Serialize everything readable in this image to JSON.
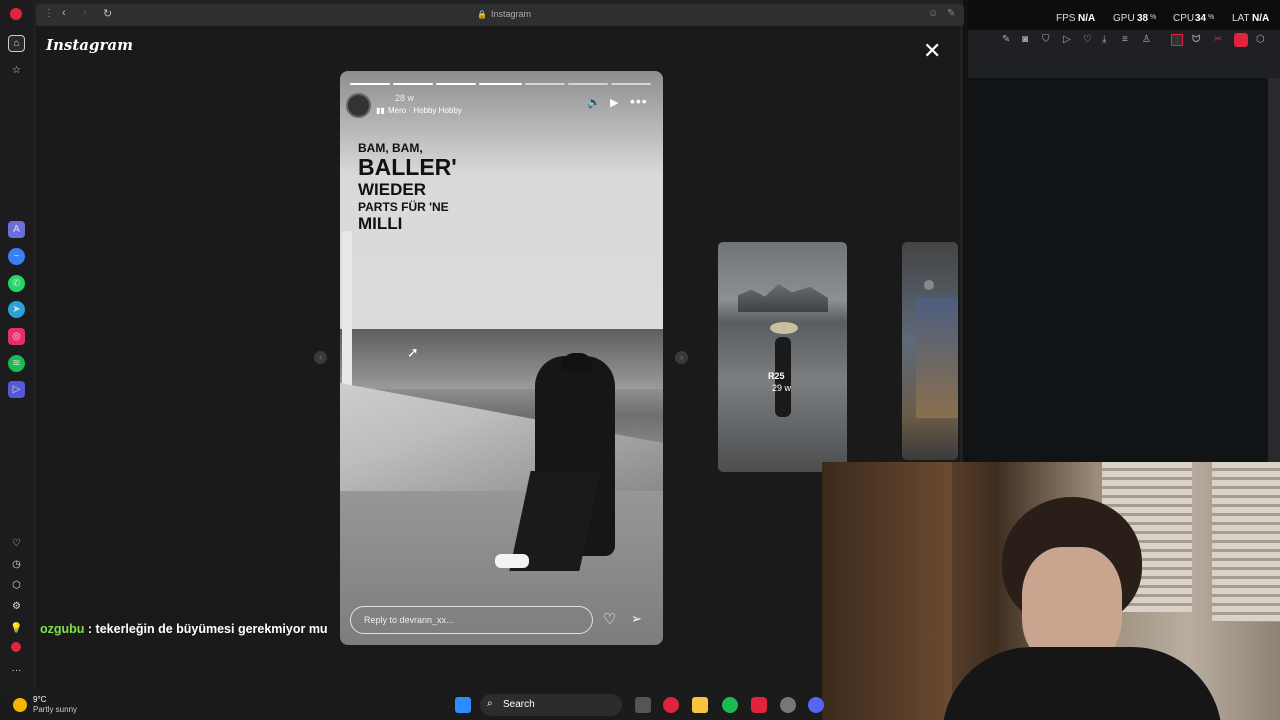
{
  "browser": {
    "url_label": "Instagram",
    "app_logo": "Instagram"
  },
  "story": {
    "username_time": "28 w",
    "music": "Mero · Hobby Hobby",
    "lyrics": [
      "BAM, BAM,",
      "BALLER'",
      "WIEDER",
      "PARTS FÜR 'NE",
      "MILLI"
    ],
    "reply_placeholder": "Reply to devrann_xx..."
  },
  "next_story": {
    "label": "R25",
    "time": "29 w"
  },
  "overlay": {
    "fps_label": "FPS",
    "fps_value": "N/A",
    "gpu_label": "GPU",
    "gpu_value": "38",
    "gpu_unit": "%",
    "cpu_label": "CPU",
    "cpu_value": "34",
    "cpu_unit": "%",
    "lat_label": "LAT",
    "lat_value": "N/A"
  },
  "chat": {
    "user": "ozgubu",
    "separator": " : ",
    "message": "tekerleğin de büyümesi gerekmiyor mu"
  },
  "taskbar": {
    "weather_temp": "9°C",
    "weather_desc": "Partly sunny",
    "search_label": "Search"
  },
  "colors": {
    "chat_user": "#7fe04a",
    "opera_red": "#e0243b",
    "instagram_pink": "#e1306c"
  }
}
